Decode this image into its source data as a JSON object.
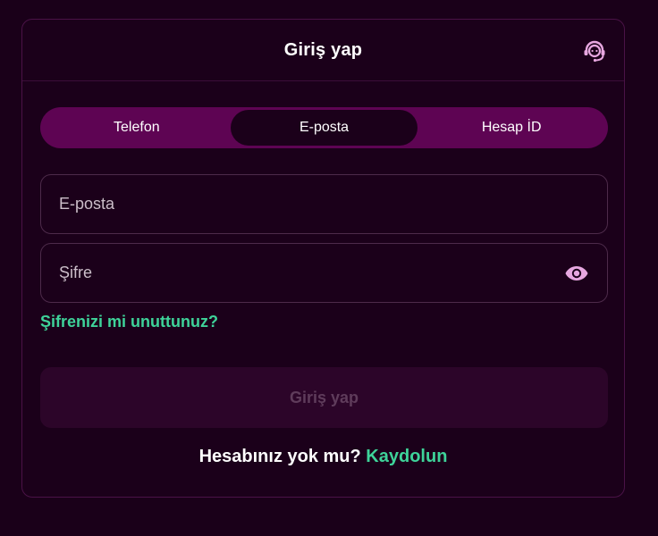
{
  "header": {
    "title": "Giriş yap",
    "support_icon": "headset-icon"
  },
  "tabs": [
    {
      "label": "Telefon",
      "active": false
    },
    {
      "label": "E-posta",
      "active": true
    },
    {
      "label": "Hesap İD",
      "active": false
    }
  ],
  "form": {
    "email": {
      "value": "",
      "placeholder": "E-posta"
    },
    "password": {
      "value": "",
      "placeholder": "Şifre",
      "toggle_icon": "eye-icon"
    },
    "forgot_label": "Şifrenizi mi unuttunuz?",
    "submit_label": "Giriş yap"
  },
  "signup": {
    "question": "Hesabınız yok mu?",
    "link_label": "Kaydolun"
  },
  "colors": {
    "background": "#1a0019",
    "tab_bar": "#5e0453",
    "accent": "#3ed39a",
    "icon": "#e7a7e0",
    "button_disabled": "#2c0529"
  }
}
